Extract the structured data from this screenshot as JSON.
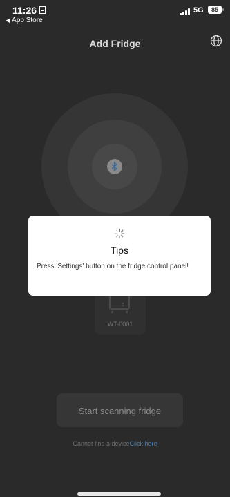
{
  "status_bar": {
    "time": "11:26",
    "back_app": "App Store",
    "network": "5G",
    "battery": "85"
  },
  "header": {
    "title": "Add Fridge",
    "language_icon": "globe-icon"
  },
  "scanner": {
    "center_icon": "bluetooth-icon"
  },
  "device": {
    "icon": "fridge-icon",
    "name": "WT-0001"
  },
  "actions": {
    "scan_label": "Start scanning fridge",
    "help_text": "Cannot find a device",
    "help_link": "Click here"
  },
  "dialog": {
    "icon": "loading-spinner-icon",
    "title": "Tips",
    "message": "Press 'Settings' button on the fridge control panel!"
  },
  "colors": {
    "background": "#2a2a2a",
    "link": "#4d7ea8",
    "dialog": "#ffffff"
  }
}
